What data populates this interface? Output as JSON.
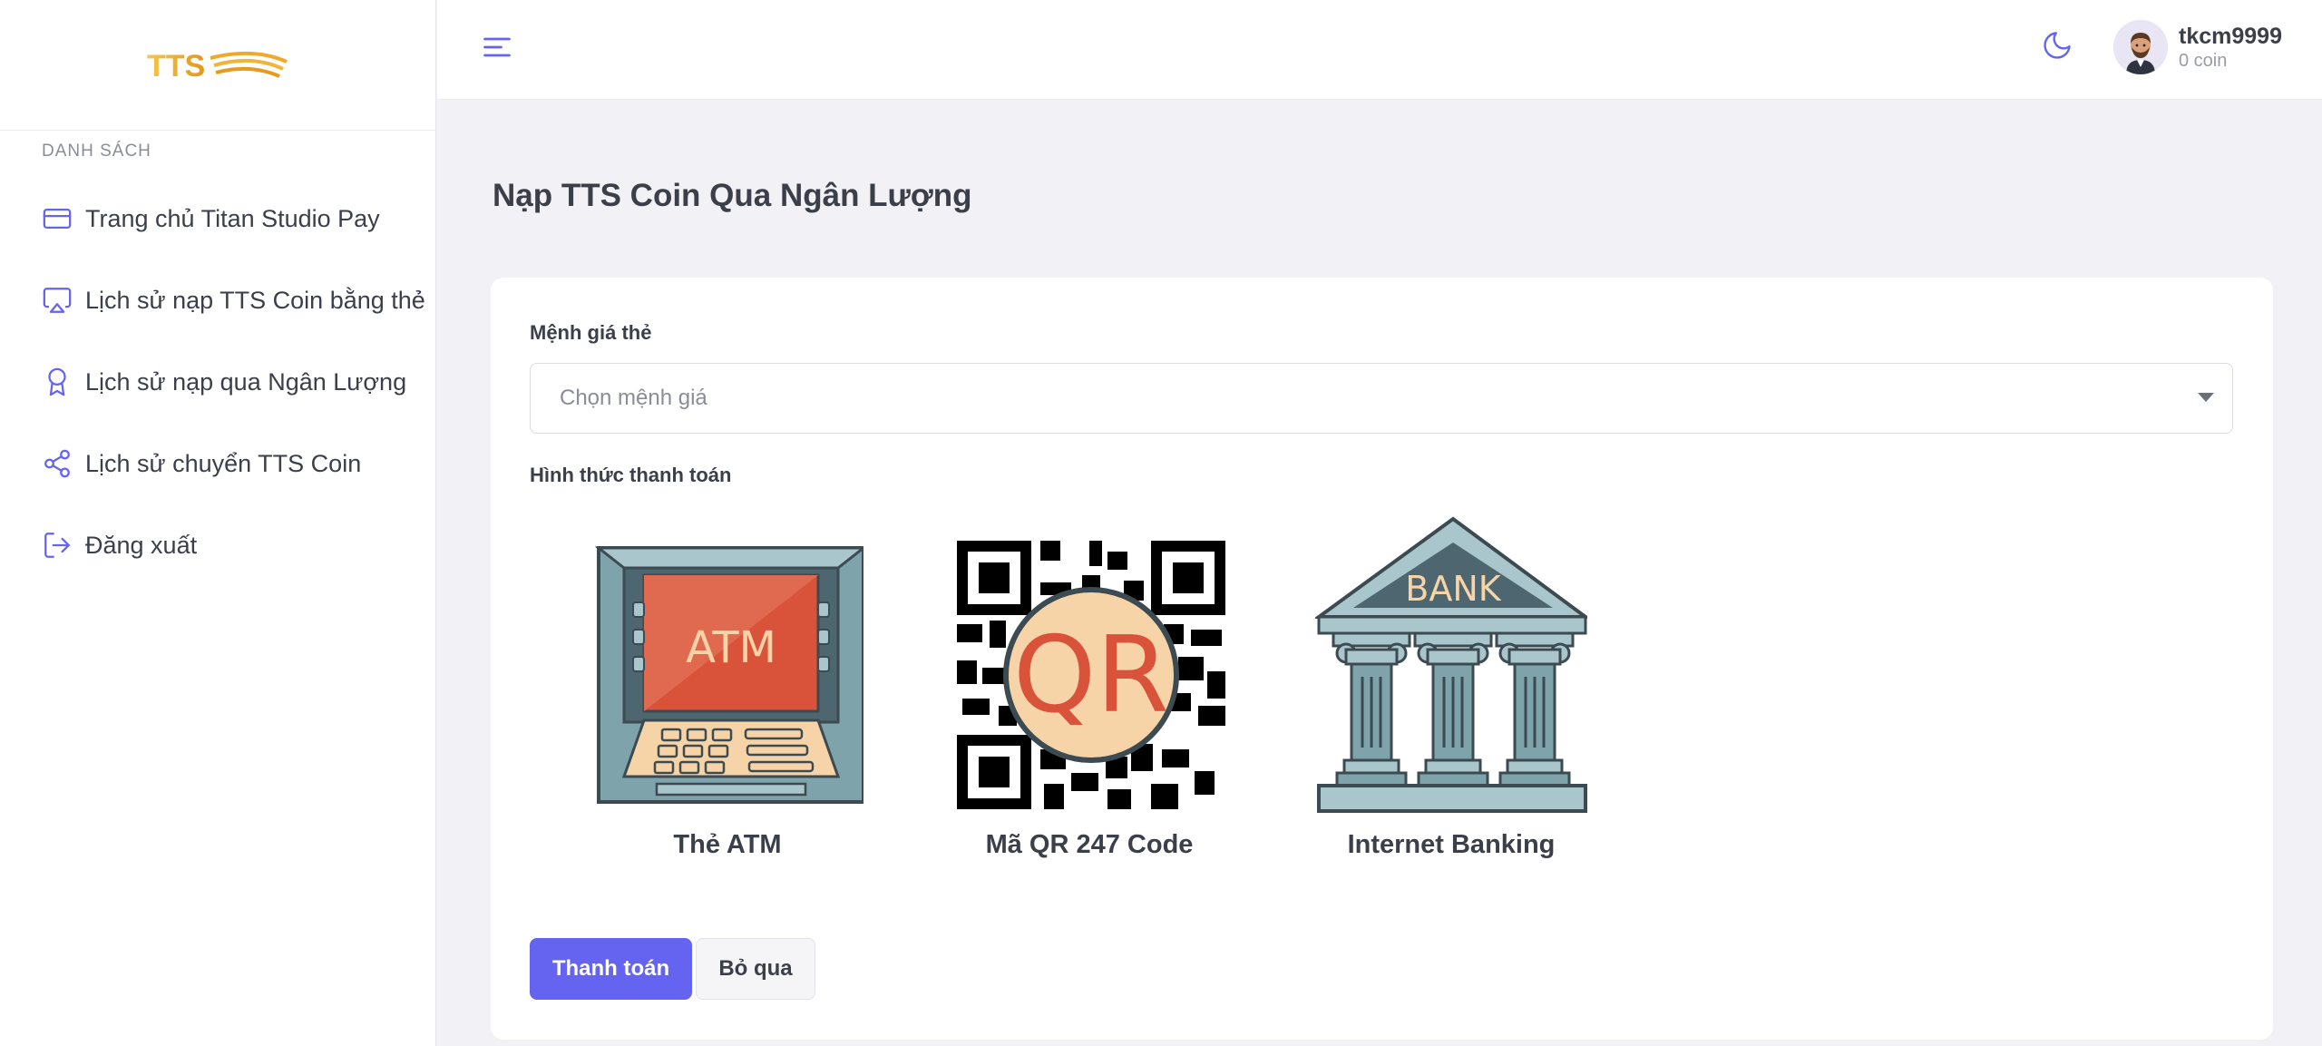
{
  "sidebar": {
    "section_title": "DANH SÁCH",
    "items": [
      {
        "label": "Trang chủ Titan Studio Pay",
        "icon": "credit-card-icon"
      },
      {
        "label": "Lịch sử nạp TTS Coin bằng thẻ",
        "icon": "airplay-icon"
      },
      {
        "label": "Lịch sử nạp qua Ngân Lượng",
        "icon": "award-icon"
      },
      {
        "label": "Lịch sử chuyển TTS Coin",
        "icon": "share-icon"
      },
      {
        "label": "Đăng xuất",
        "icon": "logout-icon"
      }
    ]
  },
  "logo": {
    "text": "TTS"
  },
  "header": {
    "user_name": "tkcm9999",
    "user_coin": "0 coin"
  },
  "main": {
    "title": "Nạp TTS Coin Qua Ngân Lượng",
    "amount_label": "Mệnh giá thẻ",
    "amount_placeholder": "Chọn mệnh giá",
    "method_label": "Hình thức thanh toán",
    "methods": [
      {
        "label": "Thẻ ATM",
        "icon_text": "ATM"
      },
      {
        "label": "Mã QR 247 Code",
        "icon_text": "QR"
      },
      {
        "label": "Internet Banking",
        "icon_text": "BANK"
      }
    ],
    "pay_button": "Thanh toán",
    "skip_button": "Bỏ qua"
  },
  "colors": {
    "accent": "#6464f0",
    "background": "#f2f2f6"
  }
}
